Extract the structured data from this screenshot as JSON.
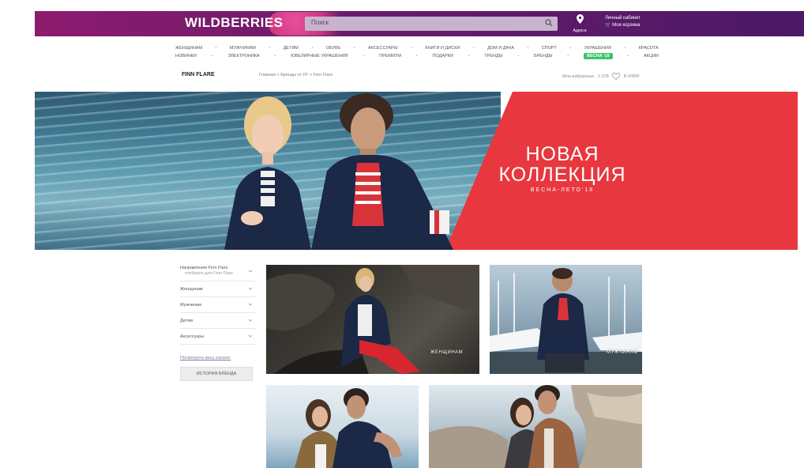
{
  "header": {
    "logo": "WILDBERRIES",
    "search_placeholder": "Поиск",
    "location_label": "Адреса",
    "account_line1": "Личный кабинет",
    "account_line2": "Моя корзина"
  },
  "nav": {
    "row1": [
      "ЖЕНЩИНАМ",
      "МУЖЧИНАМ",
      "ДЕТЯМ",
      "ОБУВЬ",
      "АКСЕССУАРЫ",
      "КНИГИ И ДИСКИ",
      "ДОМ И ДАЧА",
      "СПОРТ",
      "УКРАШЕНИЯ",
      "КРАСОТА"
    ],
    "row2": [
      "НОВИНКИ",
      "ЭЛЕКТРОНИКА",
      "ЮВЕЛИРНЫЕ УКРАШЕНИЯ",
      "ПРЕМИУМ",
      "ПОДАРКИ",
      "ТРЕНДЫ",
      "БРЕНДЫ",
      "ВЕСНА '18",
      "АКЦИИ"
    ],
    "badge_index": 7
  },
  "brandbar": {
    "brand": "FINN FLARE",
    "breadcrumb": "Главная  >  Бренды от FF  >  Finn Flare",
    "rating_label": "Мои избранные",
    "rating_value": "1 078",
    "favorites": "В ИЗБР."
  },
  "hero": {
    "title_line1": "НОВАЯ",
    "title_line2": "КОЛЛЕКЦИЯ",
    "subtitle": "ВЕСНА-ЛЕТО'18"
  },
  "sidebar": {
    "first_line1": "Направления Finn Flare",
    "first_line2": "отобрано для Finn Flare",
    "items": [
      "Женщинам",
      "Мужчинам",
      "Детям",
      "Аксессуары"
    ],
    "link": "Посмотреть весь каталог",
    "button": "ИСТОРИЯ БРЕНДА"
  },
  "tiles": {
    "women_label": "ЖЕНЩИНАМ",
    "men_label": "МУЖЧИНАМ"
  },
  "colors": {
    "header_start": "#8e1b6e",
    "header_end": "#4b1966",
    "hero_red": "#e8373e",
    "badge_green": "#3cc46a"
  }
}
